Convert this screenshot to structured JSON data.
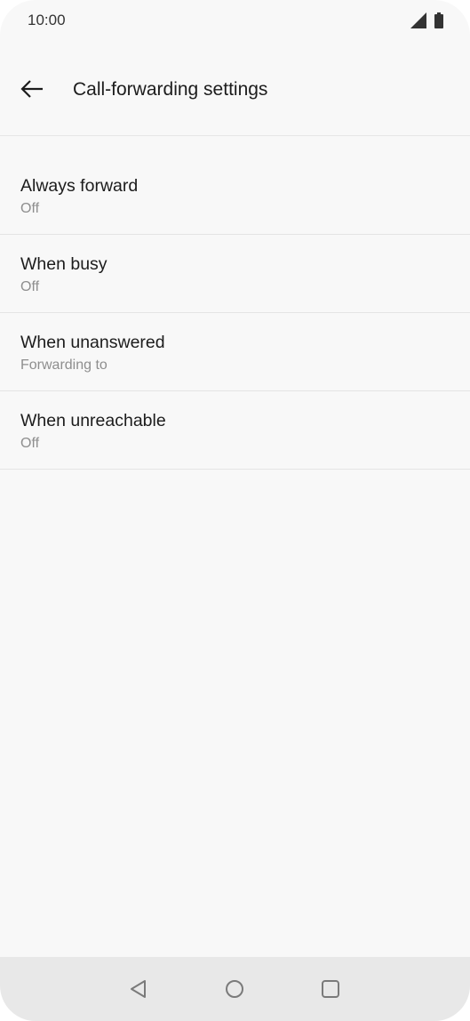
{
  "status_bar": {
    "time": "10:00",
    "icons": [
      "signal-icon",
      "battery-icon"
    ]
  },
  "header": {
    "back_icon": "arrow-left-icon",
    "title": "Call-forwarding settings"
  },
  "settings": {
    "items": [
      {
        "title": "Always forward",
        "subtitle": "Off"
      },
      {
        "title": "When busy",
        "subtitle": "Off"
      },
      {
        "title": "When unanswered",
        "subtitle": "Forwarding to"
      },
      {
        "title": "When unreachable",
        "subtitle": "Off"
      }
    ]
  },
  "nav_bar": {
    "buttons": [
      "triangle-back-icon",
      "circle-home-icon",
      "square-recents-icon"
    ]
  },
  "colors": {
    "background": "#f8f8f8",
    "title_text": "#1c1c1c",
    "subtitle_text": "#8e8e8e",
    "divider": "#e4e4e4",
    "nav_bar": "#e8e8e8"
  }
}
